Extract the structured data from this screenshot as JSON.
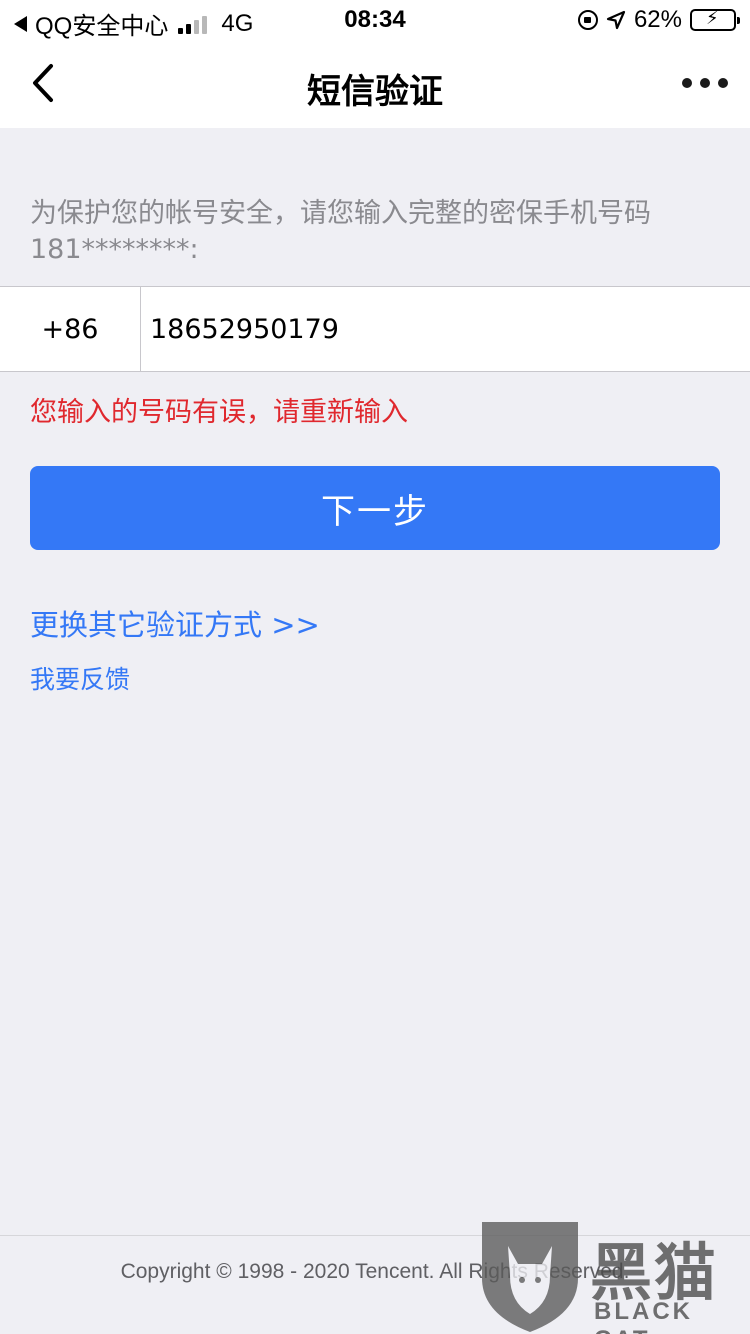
{
  "status_bar": {
    "carrier": "QQ安全中心",
    "network": "4G",
    "time": "08:34",
    "battery": "62%",
    "battery_level": 0.62
  },
  "nav": {
    "title": "短信验证",
    "back_icon": "chevron-left-icon",
    "more_icon": "more-dots-icon"
  },
  "form": {
    "hint": "为保护您的帐号安全，请您输入完整的密保手机号码181********:",
    "country_code": "+86",
    "phone_value": "18652950179",
    "error": "您输入的号码有误，请重新输入",
    "next_label": "下一步"
  },
  "links": {
    "other_method": "更换其它验证方式 >>",
    "feedback": "我要反馈"
  },
  "footer": {
    "copyright": "Copyright © 1998 - 2020 Tencent. All Rights Reserved."
  },
  "watermark": {
    "cn": "黑猫",
    "en": "BLACK CAT"
  },
  "colors": {
    "accent": "#3478f6",
    "error": "#e0282e",
    "background": "#efeff4"
  }
}
